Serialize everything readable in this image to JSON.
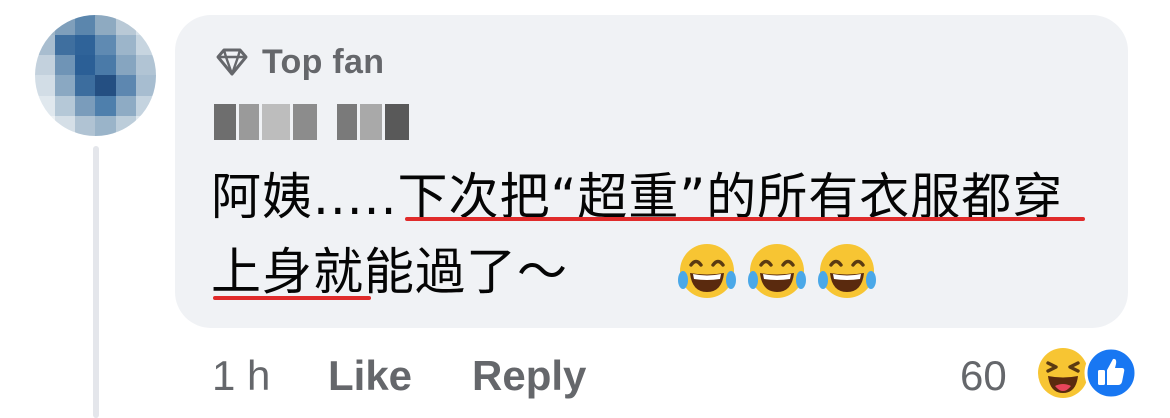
{
  "comment": {
    "badge_label": "Top fan",
    "text": "阿姨.....下次把“超重”的所有衣服都穿上身就能過了～",
    "emojis": [
      "laughing-tears",
      "laughing-tears",
      "laughing-tears"
    ]
  },
  "actions": {
    "time": "1 h",
    "like_label": "Like",
    "reply_label": "Reply"
  },
  "reactions": {
    "count": "60",
    "types": [
      "haha",
      "like"
    ]
  },
  "colors": {
    "bubble": "#f0f2f5",
    "meta_text": "#65676b",
    "body_text": "#050505",
    "underline": "#e02b2b",
    "like_blue": "#1877f2"
  }
}
